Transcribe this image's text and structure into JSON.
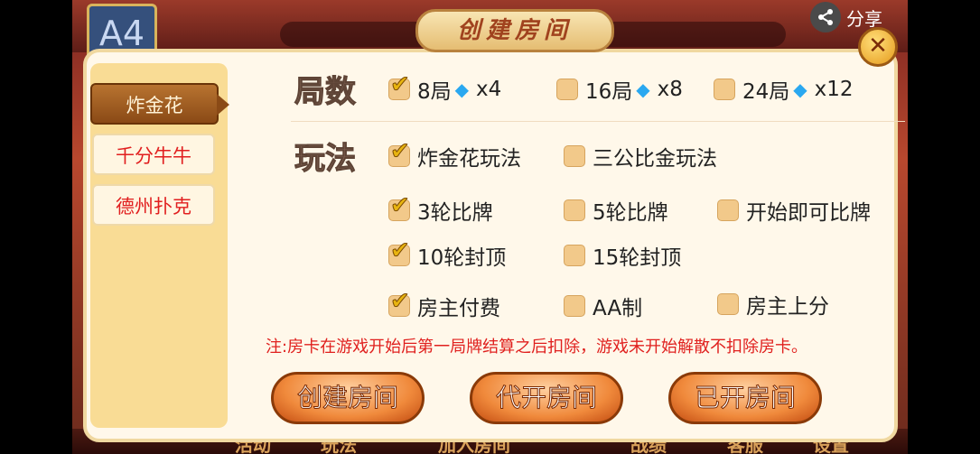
{
  "backdrop": {
    "avatar_text": "A4",
    "share_label": "分享",
    "bottom_nav": [
      "活动",
      "玩法",
      "加入房间",
      "战绩",
      "客服",
      "设置"
    ]
  },
  "dialog": {
    "title": "创建房间",
    "close_symbol": "✕"
  },
  "tabs": [
    {
      "label": "炸金花",
      "active": true
    },
    {
      "label": "千分牛牛",
      "active": false
    },
    {
      "label": "德州扑克",
      "active": false
    }
  ],
  "rounds": {
    "label": "局数",
    "options": [
      {
        "label": "8局",
        "cost": "x4",
        "checked": true
      },
      {
        "label": "16局",
        "cost": "x8",
        "checked": false
      },
      {
        "label": "24局",
        "cost": "x12",
        "checked": false
      }
    ],
    "cost_icon": "diamond-icon"
  },
  "rules": {
    "label": "玩法",
    "mode": [
      {
        "label": "炸金花玩法",
        "checked": true
      },
      {
        "label": "三公比金玩法",
        "checked": false
      }
    ],
    "compare": [
      {
        "label": "3轮比牌",
        "checked": true
      },
      {
        "label": "5轮比牌",
        "checked": false
      },
      {
        "label": "开始即可比牌",
        "checked": false
      }
    ],
    "cap": [
      {
        "label": "10轮封顶",
        "checked": true
      },
      {
        "label": "15轮封顶",
        "checked": false
      }
    ],
    "payment": [
      {
        "label": "房主付费",
        "checked": true
      },
      {
        "label": "AA制",
        "checked": false
      },
      {
        "label": "房主上分",
        "checked": false
      }
    ]
  },
  "notice": "注:房卡在游戏开始后第一局牌结算之后扣除，游戏未开始解散不扣除房卡。",
  "buttons": {
    "create": "创建房间",
    "proxy": "代开房间",
    "opened": "已开房间"
  }
}
